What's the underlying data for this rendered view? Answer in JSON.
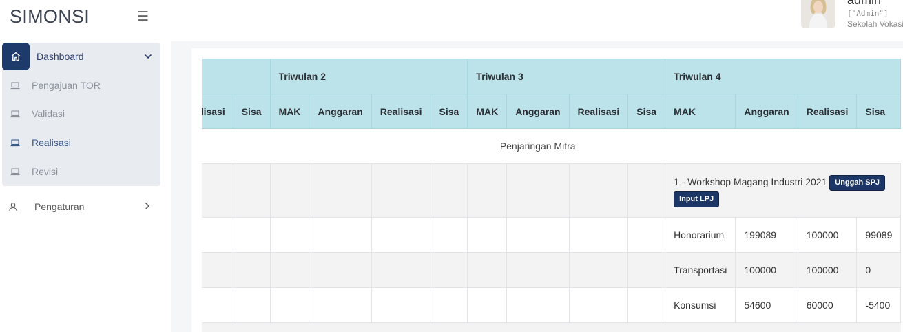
{
  "sidebar": {
    "brand": "SIMONSI",
    "dashboard_label": "Dashboard",
    "items": [
      {
        "label": "Pengajuan TOR"
      },
      {
        "label": "Validasi"
      },
      {
        "label": "Realisasi"
      },
      {
        "label": "Revisi"
      }
    ],
    "pengaturan_label": "Pengaturan"
  },
  "user": {
    "name": "admin",
    "role": "[\"Admin\"]",
    "org": "Sekolah Vokasi"
  },
  "table": {
    "quarters": [
      "Triwulan 2",
      "Triwulan 3",
      "Triwulan 4"
    ],
    "partial_cols": [
      "Realisasi",
      "Sisa"
    ],
    "quarter_cols": [
      "MAK",
      "Anggaran",
      "Realisasi",
      "Sisa"
    ],
    "section": "Penjaringan Mitra",
    "activity": {
      "label": "1 - Workshop Magang Industri 2021",
      "upload_btn": "Unggah SPJ",
      "input_btn": "Input LPJ"
    },
    "rows": [
      {
        "mak": "Honorarium",
        "anggaran": "199089",
        "realisasi": "100000",
        "sisa": "99089"
      },
      {
        "mak": "Transportasi",
        "anggaran": "100000",
        "realisasi": "100000",
        "sisa": "0"
      },
      {
        "mak": "Konsumsi",
        "anggaran": "54600",
        "realisasi": "60000",
        "sisa": "-5400"
      }
    ]
  }
}
